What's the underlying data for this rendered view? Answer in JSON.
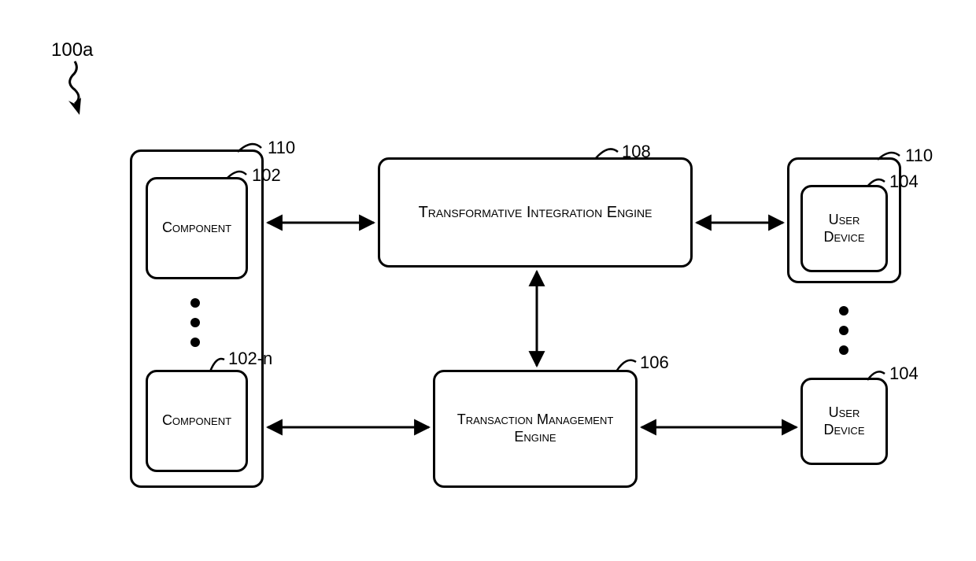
{
  "figure_id": "100a",
  "refs": {
    "left_container": "110",
    "component_top": "102",
    "component_bottom": "102-n",
    "tie": "108",
    "tme": "106",
    "user_device_top_outer": "110",
    "user_device_top_inner": "104",
    "user_device_bottom": "104"
  },
  "labels": {
    "component": "Component",
    "tie": "Transformative Integration Engine",
    "tme": "Transaction Management Engine",
    "user_device": "User Device"
  }
}
